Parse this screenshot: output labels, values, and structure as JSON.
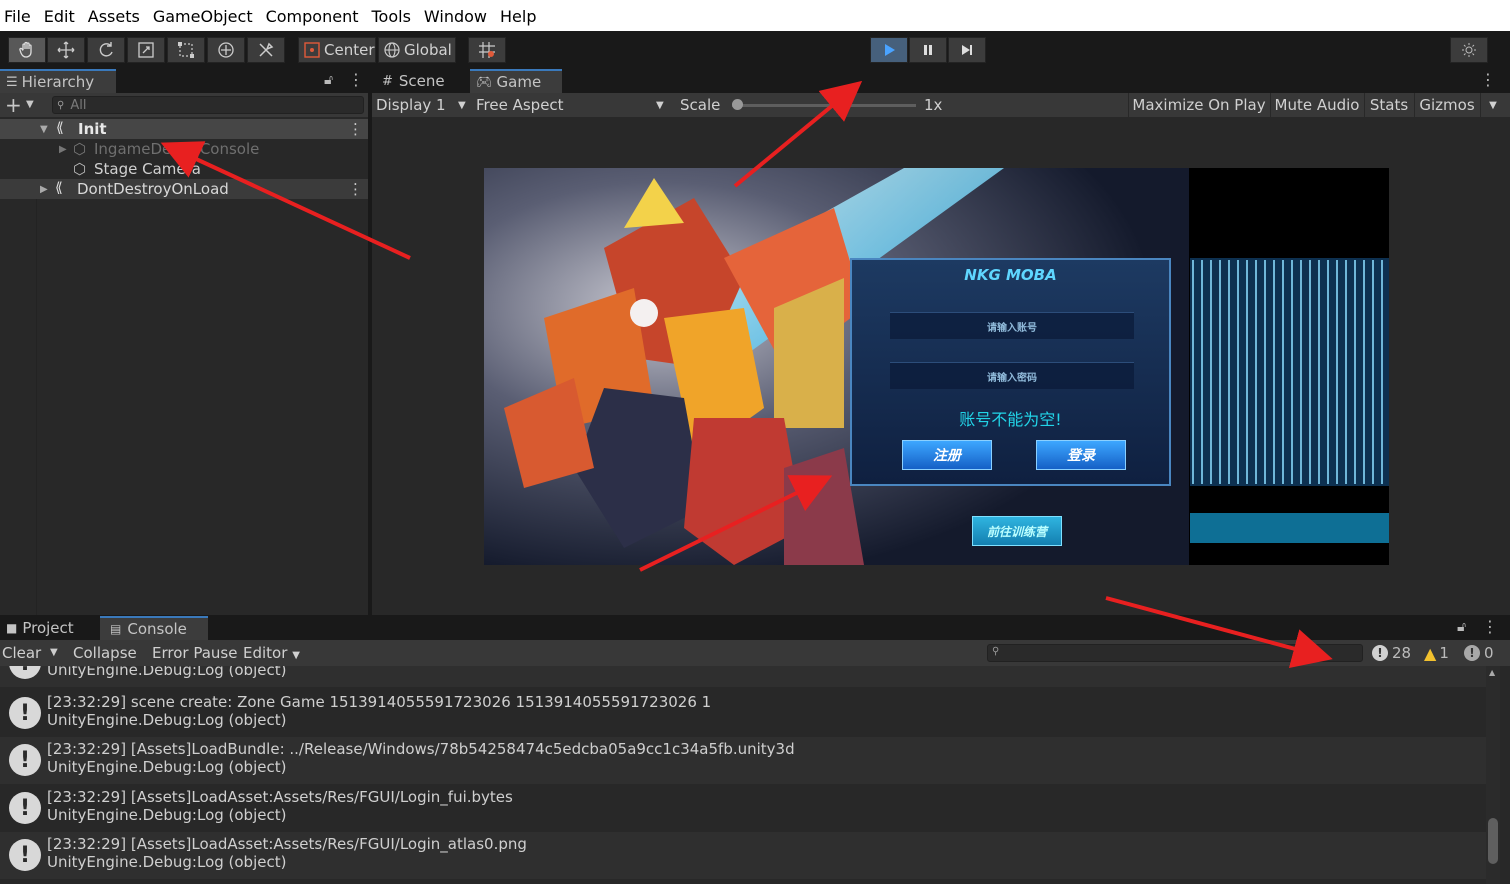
{
  "menu": [
    "File",
    "Edit",
    "Assets",
    "GameObject",
    "Component",
    "Tools",
    "Window",
    "Help"
  ],
  "toolbar": {
    "tools": [
      "hand-tool-icon",
      "move-tool-icon",
      "rotate-tool-icon",
      "scale-tool-icon",
      "rect-tool-icon",
      "transform-tool-icon",
      "custom-tool-icon"
    ],
    "pivot_label": "Center",
    "space_label": "Global",
    "play_icon": "play-icon",
    "pause_icon": "pause-icon",
    "step_icon": "step-icon"
  },
  "hierarchy": {
    "tab_label": "Hierarchy",
    "search_placeholder": "All",
    "items": [
      {
        "label": "Init",
        "selected": true
      },
      {
        "label": "IngameDebugConsole",
        "disabled": true
      },
      {
        "label": "Stage Camera"
      },
      {
        "label": "DontDestroyOnLoad"
      }
    ]
  },
  "game_panel": {
    "tabs": [
      "Scene",
      "Game"
    ],
    "display_label": "Display 1",
    "aspect_label": "Free Aspect",
    "scale_label": "Scale",
    "scale_value": "1x",
    "scale_fraction": 0.0,
    "maximize_label": "Maximize On Play",
    "mute_label": "Mute Audio",
    "stats_label": "Stats",
    "gizmos_label": "Gizmos"
  },
  "game_view": {
    "title": "NKG MOBA",
    "account_placeholder": "请输入账号",
    "password_placeholder": "请输入密码",
    "error_text": "账号不能为空!",
    "register_label": "注册",
    "login_label": "登录",
    "training_label": "前往训练营",
    "accent_color": "#1ec8e6"
  },
  "console": {
    "tabs": [
      "Project",
      "Console"
    ],
    "clear_label": "Clear",
    "collapse_label": "Collapse",
    "error_pause_label": "Error Pause",
    "editor_label": "Editor",
    "log_count": "28",
    "warning_count": "1",
    "error_count": "0",
    "partial_row": "UnityEngine.Debug:Log (object)",
    "entries": [
      {
        "message": "[23:32:29] scene create: Zone Game 1513914055591723026 1513914055591723026 1",
        "trace": "UnityEngine.Debug:Log (object)"
      },
      {
        "message": "[23:32:29] [Assets]LoadBundle: ../Release/Windows/78b54258474c5edcba05a9cc1c34a5fb.unity3d",
        "trace": "UnityEngine.Debug:Log (object)"
      },
      {
        "message": "[23:32:29] [Assets]LoadAsset:Assets/Res/FGUI/Login_fui.bytes",
        "trace": "UnityEngine.Debug:Log (object)"
      },
      {
        "message": "[23:32:29] [Assets]LoadAsset:Assets/Res/FGUI/Login_atlas0.png",
        "trace": "UnityEngine.Debug:Log (object)"
      }
    ]
  }
}
